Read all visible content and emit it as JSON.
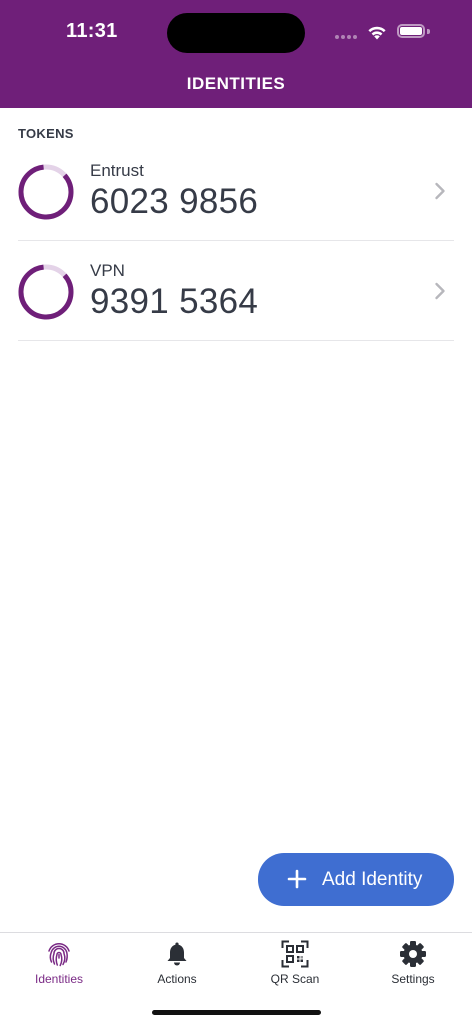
{
  "status_bar": {
    "time": "11:31"
  },
  "header": {
    "title": "IDENTITIES"
  },
  "colors": {
    "brand": "#6f1f79",
    "accent": "#3f6ed1",
    "text": "#363b47",
    "progress_track": "#e4d3e8"
  },
  "tokens": {
    "section_title": "TOKENS",
    "items": [
      {
        "name": "Entrust",
        "code": "6023 9856",
        "icon": "countdown-ring-icon",
        "remaining": 0.85
      },
      {
        "name": "VPN",
        "code": "9391 5364",
        "icon": "countdown-ring-icon",
        "remaining": 0.85
      }
    ]
  },
  "add_identity": {
    "label": "Add Identity",
    "icon": "plus-icon"
  },
  "tabbar": {
    "tabs": [
      {
        "label": "Identities",
        "icon": "fingerprint-icon",
        "active": true
      },
      {
        "label": "Actions",
        "icon": "bell-icon",
        "active": false
      },
      {
        "label": "QR Scan",
        "icon": "qr-code-icon",
        "active": false
      },
      {
        "label": "Settings",
        "icon": "gear-icon",
        "active": false
      }
    ]
  }
}
